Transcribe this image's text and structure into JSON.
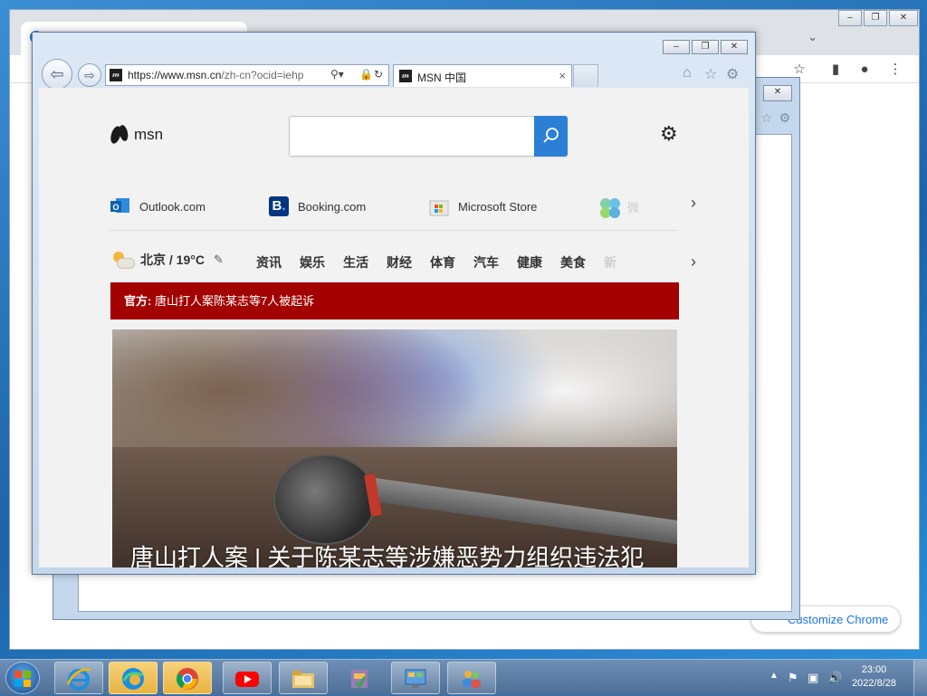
{
  "browser": {
    "address_url_main": "https://www.msn.cn",
    "address_url_rest": "/zh-cn?ocid=iehp",
    "tab_title": "MSN 中国",
    "tab_close": "×"
  },
  "window_buttons": {
    "minimize": "–",
    "restore": "❐",
    "close": "✕"
  },
  "msn": {
    "logo_text": "msn",
    "quick_links": [
      {
        "label": "Outlook.com",
        "icon": "outlook-icon"
      },
      {
        "label": "Booking.com",
        "icon": "booking-icon"
      },
      {
        "label": "Microsoft Store",
        "icon": "store-icon"
      },
      {
        "label": "微",
        "icon": "clover-icon"
      }
    ],
    "weather": "北京 / 19°C",
    "categories": [
      "资讯",
      "娱乐",
      "生活",
      "财经",
      "体育",
      "汽车",
      "健康",
      "美食",
      "新"
    ],
    "breaking": {
      "prefix": "官方:",
      "text": " 唐山打人案陈某志等7人被起诉"
    },
    "hero_headline": "唐山打人案 | 关于陈某志等涉嫌恶势力组织违法犯"
  },
  "chrome": {
    "customize_label": "Customize Chrome"
  },
  "taskbar": {
    "time": "23:00",
    "date": "2022/8/28"
  }
}
